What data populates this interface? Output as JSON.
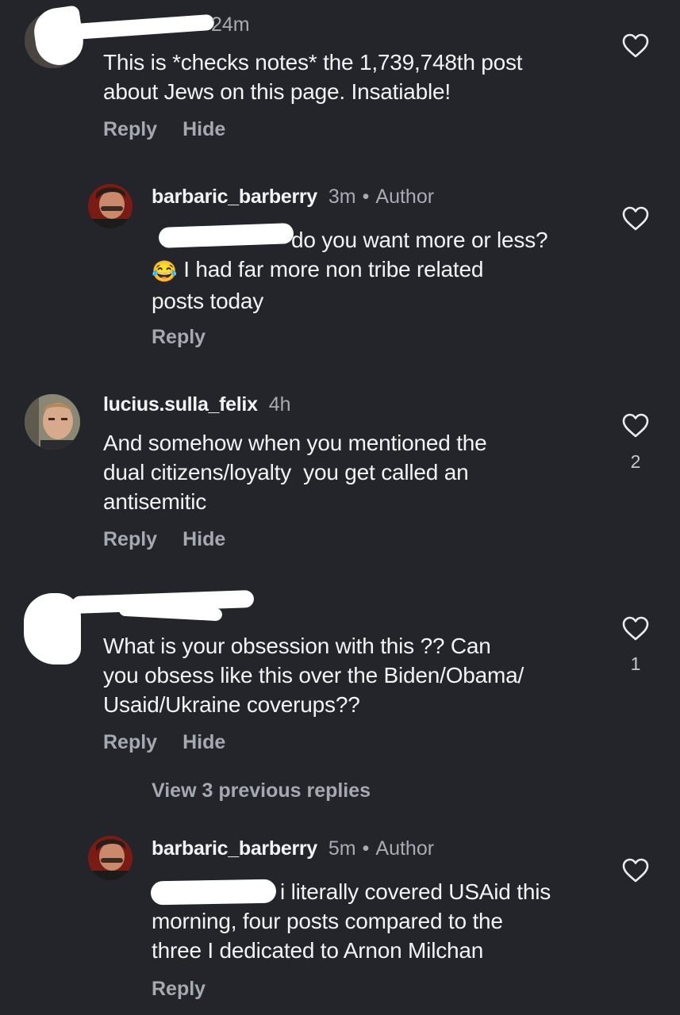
{
  "comments": [
    {
      "time": "24m",
      "lines": [
        "This is *checks notes* the 1,739,748th post",
        "about Jews on this page. Insatiable!"
      ],
      "reply_label": "Reply",
      "hide_label": "Hide",
      "like_icon": "heart-outline-icon"
    },
    {
      "username": "barbaric_barberry",
      "time": "3m",
      "author_label": "Author",
      "lines": [
        "do you want more or less?",
        "I had far more non tribe related",
        "posts today"
      ],
      "emoji": "😂",
      "reply_label": "Reply",
      "like_icon": "heart-outline-icon"
    },
    {
      "username": "lucius.sulla_felix",
      "time": "4h",
      "lines": [
        "And somehow when you mentioned the",
        "dual citizens/loyalty  you get called an",
        "antisemitic"
      ],
      "reply_label": "Reply",
      "hide_label": "Hide",
      "like_count": "2",
      "like_icon": "heart-outline-icon"
    },
    {
      "lines": [
        "What is your obsession with this ?? Can",
        "you obsess like this over the Biden/Obama/",
        "Usaid/Ukraine coverups??"
      ],
      "reply_label": "Reply",
      "hide_label": "Hide",
      "like_count": "1",
      "like_icon": "heart-outline-icon"
    },
    {
      "username": "barbaric_barberry",
      "time": "5m",
      "author_label": "Author",
      "lines": [
        "i literally covered USAid this",
        "morning, four posts compared to the",
        "three I dedicated to Arnon Milchan"
      ],
      "reply_label": "Reply",
      "like_icon": "heart-outline-icon"
    }
  ],
  "view_previous_replies": "View 3 previous replies",
  "colors": {
    "background": "#23252b",
    "text": "#f2f3f5",
    "muted": "#a7abb2",
    "redaction": "#ffffff"
  }
}
